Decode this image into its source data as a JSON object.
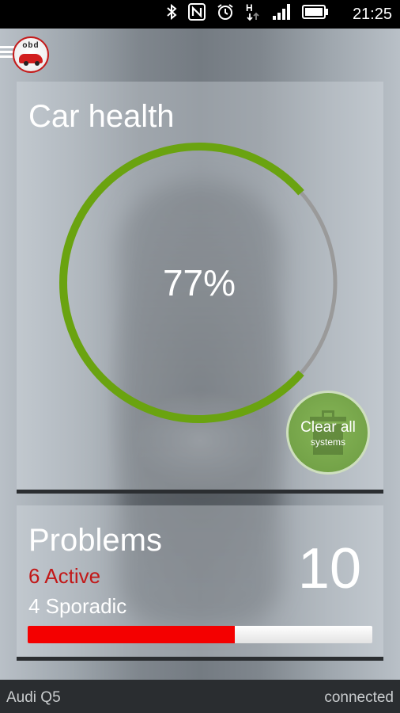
{
  "status_bar": {
    "time": "21:25",
    "icons": [
      "bluetooth-icon",
      "nfc-icon",
      "alarm-icon",
      "data-transfer-icon",
      "signal-icon",
      "battery-icon"
    ],
    "signal_glyph": "H"
  },
  "app": {
    "logo_text": "obd",
    "accent_color": "#6aa310"
  },
  "car_health": {
    "title": "Car health",
    "percent": 77,
    "value_label": "77%",
    "gauge_color": "#6aa310",
    "gauge_track_color": "#9a9a9a"
  },
  "clear_button": {
    "label": "Clear all",
    "sublabel": "systems"
  },
  "problems": {
    "title": "Problems",
    "active_label": "6 Active",
    "sporadic_label": "4 Sporadic",
    "count": "10",
    "active_fraction": 0.6,
    "active_color": "#f40000"
  },
  "footer": {
    "vehicle": "Audi Q5",
    "status": "connected"
  }
}
